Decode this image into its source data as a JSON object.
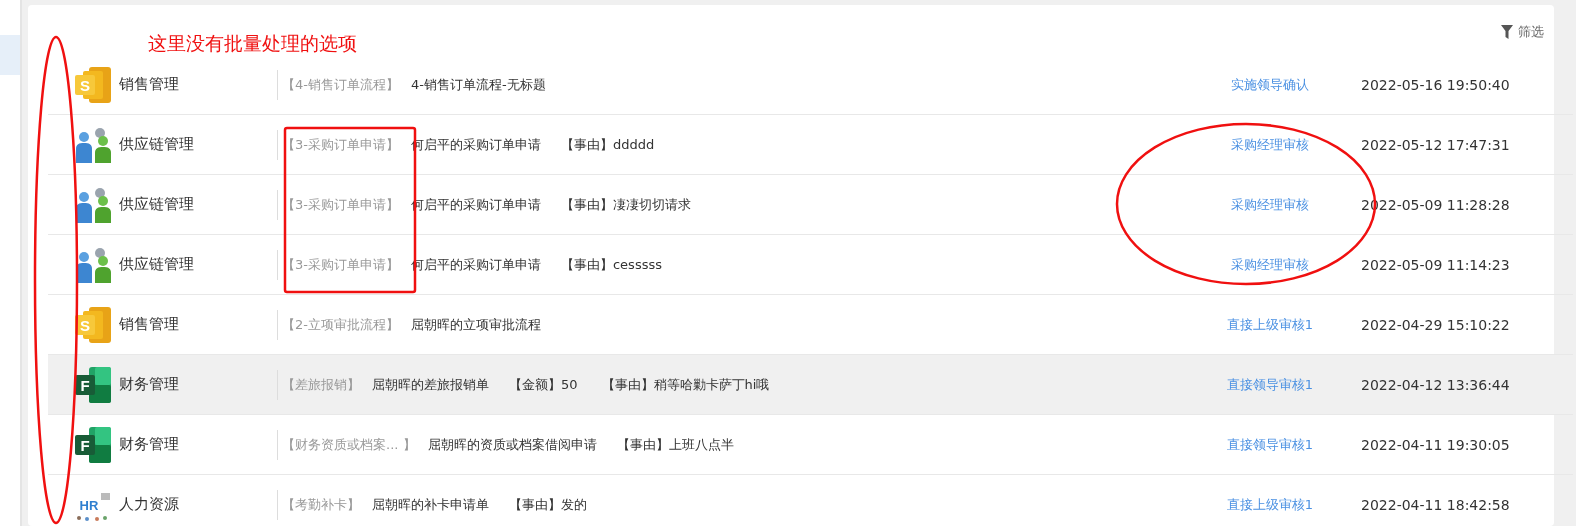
{
  "toolbar": {
    "filter_label": "筛选"
  },
  "annotation": {
    "note": "这里没有批量处理的选项"
  },
  "rows": [
    {
      "kind": "sales",
      "icon_letter": "S",
      "app": "销售管理",
      "tag": "【4-销售订单流程】",
      "title": "4-销售订单流程-无标题",
      "extras": [],
      "status": "实施领导确认",
      "date": "2022-05-16 19:50:40",
      "highlighted": false
    },
    {
      "kind": "supply",
      "app": "供应链管理",
      "tag": "【3-采购订单申请】",
      "title": "何启平的采购订单申请",
      "extras": [
        "【事由】ddddd"
      ],
      "status": "采购经理审核",
      "date": "2022-05-12 17:47:31",
      "highlighted": false
    },
    {
      "kind": "supply",
      "app": "供应链管理",
      "tag": "【3-采购订单申请】",
      "title": "何启平的采购订单申请",
      "extras": [
        "【事由】凄凄切切请求"
      ],
      "status": "采购经理审核",
      "date": "2022-05-09 11:28:28",
      "highlighted": false
    },
    {
      "kind": "supply",
      "app": "供应链管理",
      "tag": "【3-采购订单申请】",
      "title": "何启平的采购订单申请",
      "extras": [
        "【事由】cesssss"
      ],
      "status": "采购经理审核",
      "date": "2022-05-09 11:14:23",
      "highlighted": false
    },
    {
      "kind": "sales",
      "icon_letter": "S",
      "app": "销售管理",
      "tag": "【2-立项审批流程】",
      "title": "屈朝晖的立项审批流程",
      "extras": [],
      "status": "直接上级审核1",
      "date": "2022-04-29 15:10:22",
      "highlighted": false
    },
    {
      "kind": "finance",
      "icon_letter": "F",
      "app": "财务管理",
      "tag": "【差旅报销】",
      "title": "屈朝晖的差旅报销单",
      "extras": [
        "【金额】50",
        "【事由】稍等哈勦卡萨丁hi哦"
      ],
      "status": "直接领导审核1",
      "date": "2022-04-12 13:36:44",
      "highlighted": true
    },
    {
      "kind": "finance",
      "icon_letter": "F",
      "app": "财务管理",
      "tag": "【财务资质或档案... 】",
      "title": "屈朝晖的资质或档案借阅申请",
      "extras": [
        "【事由】上班八点半"
      ],
      "status": "直接领导审核1",
      "date": "2022-04-11 19:30:05",
      "highlighted": false
    },
    {
      "kind": "hr",
      "icon_letter": "HR",
      "app": "人力资源",
      "tag": "【考勤补卡】",
      "title": "屈朝晖的补卡申请单",
      "extras": [
        "【事由】发的"
      ],
      "status": "直接上级审核1",
      "date": "2022-04-11 18:42:58",
      "highlighted": false
    }
  ]
}
